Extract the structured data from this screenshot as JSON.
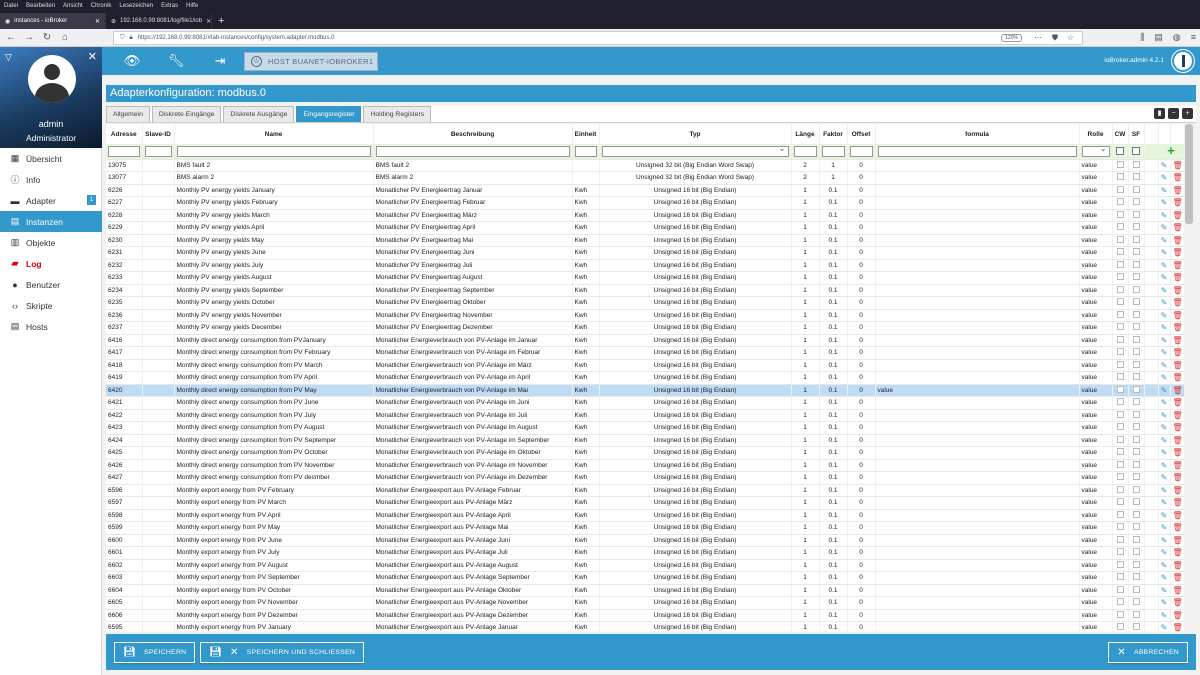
{
  "browser": {
    "menu": [
      "Datei",
      "Bearbeiten",
      "Ansicht",
      "Chronik",
      "Lesezeichen",
      "Extras",
      "Hilfe"
    ],
    "tabs": [
      {
        "label": "instances - ioBroker"
      },
      {
        "label": "192.168.0.99:8081/log/file1/iob"
      }
    ],
    "url": "https://192.168.0.99:8081/#tab-instances/config/system.adapter.modbus.0",
    "zoom": "120%"
  },
  "sidebar": {
    "user": "admin",
    "role": "Administrator",
    "items": [
      {
        "label": "Übersicht",
        "icon": "grid-icon"
      },
      {
        "label": "Info",
        "icon": "info-icon"
      },
      {
        "label": "Adapter",
        "icon": "store-icon",
        "badge": "1"
      },
      {
        "label": "Instanzen",
        "icon": "instances-icon"
      },
      {
        "label": "Objekte",
        "icon": "objects-icon"
      },
      {
        "label": "Log",
        "icon": "log-icon"
      },
      {
        "label": "Benutzer",
        "icon": "user-icon"
      },
      {
        "label": "Skripte",
        "icon": "code-icon"
      },
      {
        "label": "Hosts",
        "icon": "hosts-icon"
      }
    ]
  },
  "toolbar": {
    "host": "HOST BUANET-IOBROKER1",
    "version": "ioBroker.admin 4.2.1"
  },
  "page": {
    "title": "Adapterkonfiguration: modbus.0"
  },
  "tabs": [
    "Allgemein",
    "Diskrete Eingänge",
    "Diskrete Ausgänge",
    "Eingangsregister",
    "Holding Registers"
  ],
  "table": {
    "headers": [
      "Adresse",
      "Slave-ID",
      "Name",
      "Beschreibung",
      "Einheit",
      "Typ",
      "Länge",
      "Faktor",
      "Offset",
      "formula",
      "Rolle",
      "CW",
      "SF"
    ],
    "rows": [
      [
        "13075",
        "",
        "BMS fault 2",
        "BMS fault 2",
        "",
        "Unsigned 32 bit (Big Endian Word Swap)",
        "2",
        "1",
        "0",
        "",
        "value"
      ],
      [
        "13077",
        "",
        "BMS alarm 2",
        "BMS alarm 2",
        "",
        "Unsigned 32 bit (Big Endian Word Swap)",
        "2",
        "1",
        "0",
        "",
        "value"
      ],
      [
        "6226",
        "",
        "Monthly PV energy yields January",
        "Monatlicher PV Energieertrag Januar",
        "Kwh",
        "Unsigned 16 bit (Big Endian)",
        "1",
        "0.1",
        "0",
        "",
        "value"
      ],
      [
        "6227",
        "",
        "Monthly PV energy yields February",
        "Monatlicher PV Energieertrag Februar",
        "Kwh",
        "Unsigned 16 bit (Big Endian)",
        "1",
        "0.1",
        "0",
        "",
        "value"
      ],
      [
        "6228",
        "",
        "Monthly PV energy yields March",
        "Monatlicher PV Energieertrag März",
        "Kwh",
        "Unsigned 16 bit (Big Endian)",
        "1",
        "0.1",
        "0",
        "",
        "value"
      ],
      [
        "6229",
        "",
        "Monthly PV energy yields April",
        "Monatlicher PV Energieertrag April",
        "Kwh",
        "Unsigned 16 bit (Big Endian)",
        "1",
        "0.1",
        "0",
        "",
        "value"
      ],
      [
        "6230",
        "",
        "Monthly PV energy yields May",
        "Monatlicher PV Energieertrag Mai",
        "Kwh",
        "Unsigned 16 bit (Big Endian)",
        "1",
        "0.1",
        "0",
        "",
        "value"
      ],
      [
        "6231",
        "",
        "Monthly PV energy yields June",
        "Monatlicher PV Energieertrag Juni",
        "Kwh",
        "Unsigned 16 bit (Big Endian)",
        "1",
        "0.1",
        "0",
        "",
        "value"
      ],
      [
        "6232",
        "",
        "Monthly PV energy yields July",
        "Monatlicher PV Energieertrag Juli",
        "Kwh",
        "Unsigned 16 bit (Big Endian)",
        "1",
        "0.1",
        "0",
        "",
        "value"
      ],
      [
        "6233",
        "",
        "Monthly PV energy yields August",
        "Monatlicher PV Energieertrag August",
        "Kwh",
        "Unsigned 16 bit (Big Endian)",
        "1",
        "0.1",
        "0",
        "",
        "value"
      ],
      [
        "6234",
        "",
        "Monthly PV energy yields September",
        "Monatlicher PV Energieertrag September",
        "Kwh",
        "Unsigned 16 bit (Big Endian)",
        "1",
        "0.1",
        "0",
        "",
        "value"
      ],
      [
        "6235",
        "",
        "Monthly PV energy yields October",
        "Monatlicher PV Energieertrag Oktober",
        "Kwh",
        "Unsigned 16 bit (Big Endian)",
        "1",
        "0.1",
        "0",
        "",
        "value"
      ],
      [
        "6236",
        "",
        "Monthly PV energy yields November",
        "Monatlicher PV Energieertrag November",
        "Kwh",
        "Unsigned 16 bit (Big Endian)",
        "1",
        "0.1",
        "0",
        "",
        "value"
      ],
      [
        "6237",
        "",
        "Monthly PV energy yields December",
        "Monatlicher PV Energieertrag Dezember",
        "Kwh",
        "Unsigned 16 bit (Big Endian)",
        "1",
        "0.1",
        "0",
        "",
        "value"
      ],
      [
        "6416",
        "",
        "Monthly direct energy consumption from PVJanuary",
        "Monatlicher Energieverbrauch von PV-Anlage im Januar",
        "Kwh",
        "Unsigned 16 bit (Big Endian)",
        "1",
        "0.1",
        "0",
        "",
        "value"
      ],
      [
        "6417",
        "",
        "Monthly direct energy consumption from PV February",
        "Monatlicher Energieverbrauch von PV-Anlage im Februar",
        "Kwh",
        "Unsigned 16 bit (Big Endian)",
        "1",
        "0.1",
        "0",
        "",
        "value"
      ],
      [
        "6418",
        "",
        "Monthly direct energy consumption from PV March",
        "Monatlicher Energieverbrauch von PV-Anlage im März",
        "Kwh",
        "Unsigned 16 bit (Big Endian)",
        "1",
        "0.1",
        "0",
        "",
        "value"
      ],
      [
        "6419",
        "",
        "Monthly direct energy consumption from PV April",
        "Monatlicher Energieverbrauch von PV-Anlage im April",
        "Kwh",
        "Unsigned 16 bit (Big Endian)",
        "1",
        "0.1",
        "0",
        "",
        "value"
      ],
      [
        "6420",
        "",
        "Monthly direct energy consumption from PV May",
        "Monatlicher Energieverbrauch von PV-Anlage im Mai",
        "Kwh",
        "Unsigned 16 bit (Big Endian)",
        "1",
        "0.1",
        "0",
        "value",
        "value"
      ],
      [
        "6421",
        "",
        "Monthly direct energy consumption from PV June",
        "Monatlicher Energieverbrauch von PV-Anlage im Juni",
        "Kwh",
        "Unsigned 16 bit (Big Endian)",
        "1",
        "0.1",
        "0",
        "",
        "value"
      ],
      [
        "6422",
        "",
        "Monthly direct energy consumption from PV July",
        "Monatlicher Energieverbrauch von PV-Anlage im Juli",
        "Kwh",
        "Unsigned 16 bit (Big Endian)",
        "1",
        "0.1",
        "0",
        "",
        "value"
      ],
      [
        "6423",
        "",
        "Monthly direct energy consumption from PV August",
        "Monatlicher Energieverbrauch von PV-Anlage im August",
        "Kwh",
        "Unsigned 16 bit (Big Endian)",
        "1",
        "0.1",
        "0",
        "",
        "value"
      ],
      [
        "6424",
        "",
        "Monthly direct energy consumption from PV Septemper",
        "Monatlicher Energieverbrauch von PV-Anlage im September",
        "Kwh",
        "Unsigned 16 bit (Big Endian)",
        "1",
        "0.1",
        "0",
        "",
        "value"
      ],
      [
        "6425",
        "",
        "Monthly direct energy consumption from PV October",
        "Monatlicher Energieverbrauch von PV-Anlage im Oktober",
        "Kwh",
        "Unsigned 16 bit (Big Endian)",
        "1",
        "0.1",
        "0",
        "",
        "value"
      ],
      [
        "6426",
        "",
        "Monthly direct energy consumption from PV November",
        "Monatlicher Energieverbrauch von PV-Anlage im November",
        "Kwh",
        "Unsigned 16 bit (Big Endian)",
        "1",
        "0.1",
        "0",
        "",
        "value"
      ],
      [
        "6427",
        "",
        "Monthly direct energy consumption from PV decmber",
        "Monatlicher Energieverbrauch von PV-Anlage im Dezember",
        "Kwh",
        "Unsigned 16 bit (Big Endian)",
        "1",
        "0.1",
        "0",
        "",
        "value"
      ],
      [
        "6596",
        "",
        "Monthly export energy from PV February",
        "Monatlicher Energieexport aus PV-Anlage Februar",
        "Kwh",
        "Unsigned 16 bit (Big Endian)",
        "1",
        "0.1",
        "0",
        "",
        "value"
      ],
      [
        "6597",
        "",
        "Monthly export energy from PV March",
        "Monatlicher Energieexport aus PV-Anlage März",
        "Kwh",
        "Unsigned 16 bit (Big Endian)",
        "1",
        "0.1",
        "0",
        "",
        "value"
      ],
      [
        "6598",
        "",
        "Monthly export energy from PV April",
        "Monatlicher Energieexport aus PV-Anlage April",
        "Kwh",
        "Unsigned 16 bit (Big Endian)",
        "1",
        "0.1",
        "0",
        "",
        "value"
      ],
      [
        "6599",
        "",
        "Monthly export energy from PV May",
        "Monatlicher Energieexport aus PV-Anlage Mai",
        "Kwh",
        "Unsigned 16 bit (Big Endian)",
        "1",
        "0.1",
        "0",
        "",
        "value"
      ],
      [
        "6600",
        "",
        "Monthly export energy from PV June",
        "Monatlicher Energieexport aus PV-Anlage Juni",
        "Kwh",
        "Unsigned 16 bit (Big Endian)",
        "1",
        "0.1",
        "0",
        "",
        "value"
      ],
      [
        "6601",
        "",
        "Monthly export energy from PV July",
        "Monatlicher Energieexport aus PV-Anlage Juli",
        "Kwh",
        "Unsigned 16 bit (Big Endian)",
        "1",
        "0.1",
        "0",
        "",
        "value"
      ],
      [
        "6602",
        "",
        "Monthly export energy from PV August",
        "Monatlicher Energieexport aus PV-Anlage August",
        "Kwh",
        "Unsigned 16 bit (Big Endian)",
        "1",
        "0.1",
        "0",
        "",
        "value"
      ],
      [
        "6603",
        "",
        "Monthly export energy from PV September",
        "Monatlicher Energieexport aus PV-Anlage September",
        "Kwh",
        "Unsigned 16 bit (Big Endian)",
        "1",
        "0.1",
        "0",
        "",
        "value"
      ],
      [
        "6604",
        "",
        "Monthly export energy from PV October",
        "Monatlicher Energieexport aus PV-Anlage Oktober",
        "Kwh",
        "Unsigned 16 bit (Big Endian)",
        "1",
        "0.1",
        "0",
        "",
        "value"
      ],
      [
        "6605",
        "",
        "Monthly export energy from PV November",
        "Monatlicher Energieexport aus PV-Anlage November",
        "Kwh",
        "Unsigned 16 bit (Big Endian)",
        "1",
        "0.1",
        "0",
        "",
        "value"
      ],
      [
        "6606",
        "",
        "Monthly export energy from PV Dezember",
        "Monatlicher Energieexport aus PV-Anlage Dezember",
        "Kwh",
        "Unsigned 16 bit (Big Endian)",
        "1",
        "0.1",
        "0",
        "",
        "value"
      ],
      [
        "6595",
        "",
        "Monthly export energy from PV January",
        "Monatlicher Energieexport aus PV-Anlage Januar",
        "Kwh",
        "Unsigned 16 bit (Big Endian)",
        "1",
        "0.1",
        "0",
        "",
        "value"
      ]
    ],
    "highlight_address": "6420"
  },
  "buttons": {
    "save": "SPEICHERN",
    "save_close": "SPEICHERN UND SCHLIESSEN",
    "cancel": "ABBRECHEN"
  },
  "colors": {
    "accent": "#3399cc",
    "highlight_row": "#bfdcf4",
    "filter_row": "#e4f5dc",
    "delete": "#dd3333",
    "add": "#22aa22"
  }
}
